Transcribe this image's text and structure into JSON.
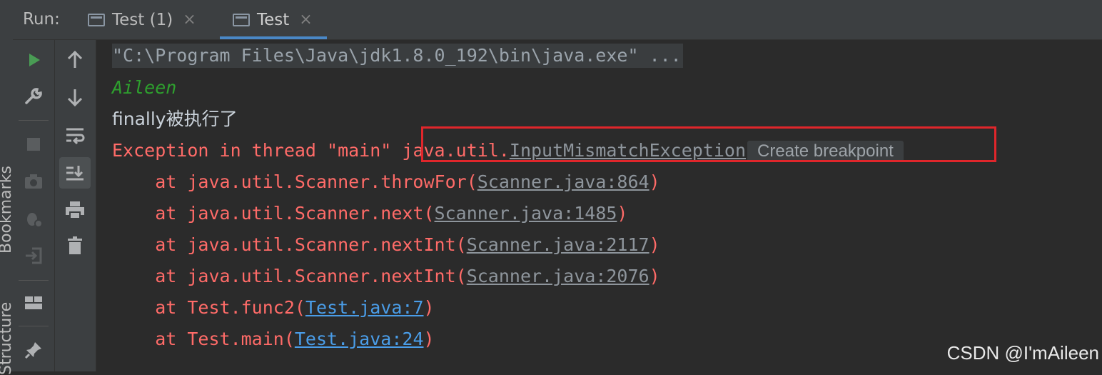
{
  "side_strip": {
    "labels": [
      "Bookmarks",
      "Structure"
    ]
  },
  "header": {
    "run_label": "Run:",
    "tabs": [
      {
        "label": "Test (1)",
        "icon": "console-window-icon",
        "close": "×"
      },
      {
        "label": "Test",
        "icon": "console-window-icon",
        "close": "×",
        "active": true
      }
    ]
  },
  "toolbar_left": [
    "rerun-icon",
    "wrench-icon",
    "stop-icon",
    "camera-icon",
    "debug-settings-icon",
    "login-icon",
    "layout-icon",
    "pin-icon"
  ],
  "toolbar_right": [
    "up-arrow-icon",
    "down-arrow-icon",
    "soft-wrap-icon",
    "scroll-to-end-icon",
    "print-icon",
    "trash-icon"
  ],
  "console": {
    "command": "\"C:\\Program Files\\Java\\jdk1.8.0_192\\bin\\java.exe\" ...",
    "output_name": "Aileen",
    "finally_text": "finally被执行了",
    "exception_prefix": "Exception in thread \"main\" ",
    "exception_pkg": "java.util.",
    "exception_class": "InputMismatchException",
    "hint": "Create breakpoint",
    "stack": [
      {
        "prefix": "    at java.util.Scanner.throwFor(",
        "ref": "Scanner.java:864",
        "suffix": ")",
        "kind": "lib"
      },
      {
        "prefix": "    at java.util.Scanner.next(",
        "ref": "Scanner.java:1485",
        "suffix": ")",
        "kind": "lib"
      },
      {
        "prefix": "    at java.util.Scanner.nextInt(",
        "ref": "Scanner.java:2117",
        "suffix": ")",
        "kind": "lib"
      },
      {
        "prefix": "    at java.util.Scanner.nextInt(",
        "ref": "Scanner.java:2076",
        "suffix": ")",
        "kind": "lib"
      },
      {
        "prefix": "    at Test.func2(",
        "ref": "Test.java:7",
        "suffix": ")",
        "kind": "user"
      },
      {
        "prefix": "    at Test.main(",
        "ref": "Test.java:24",
        "suffix": ")",
        "kind": "user"
      }
    ]
  },
  "colors": {
    "background": "#2b2b2b",
    "error_red": "#ff6b68",
    "output_green": "#2ea02e",
    "link_blue": "#4a9de8",
    "annotation_red": "#e0262b"
  },
  "watermark": "CSDN @I'mAileen"
}
